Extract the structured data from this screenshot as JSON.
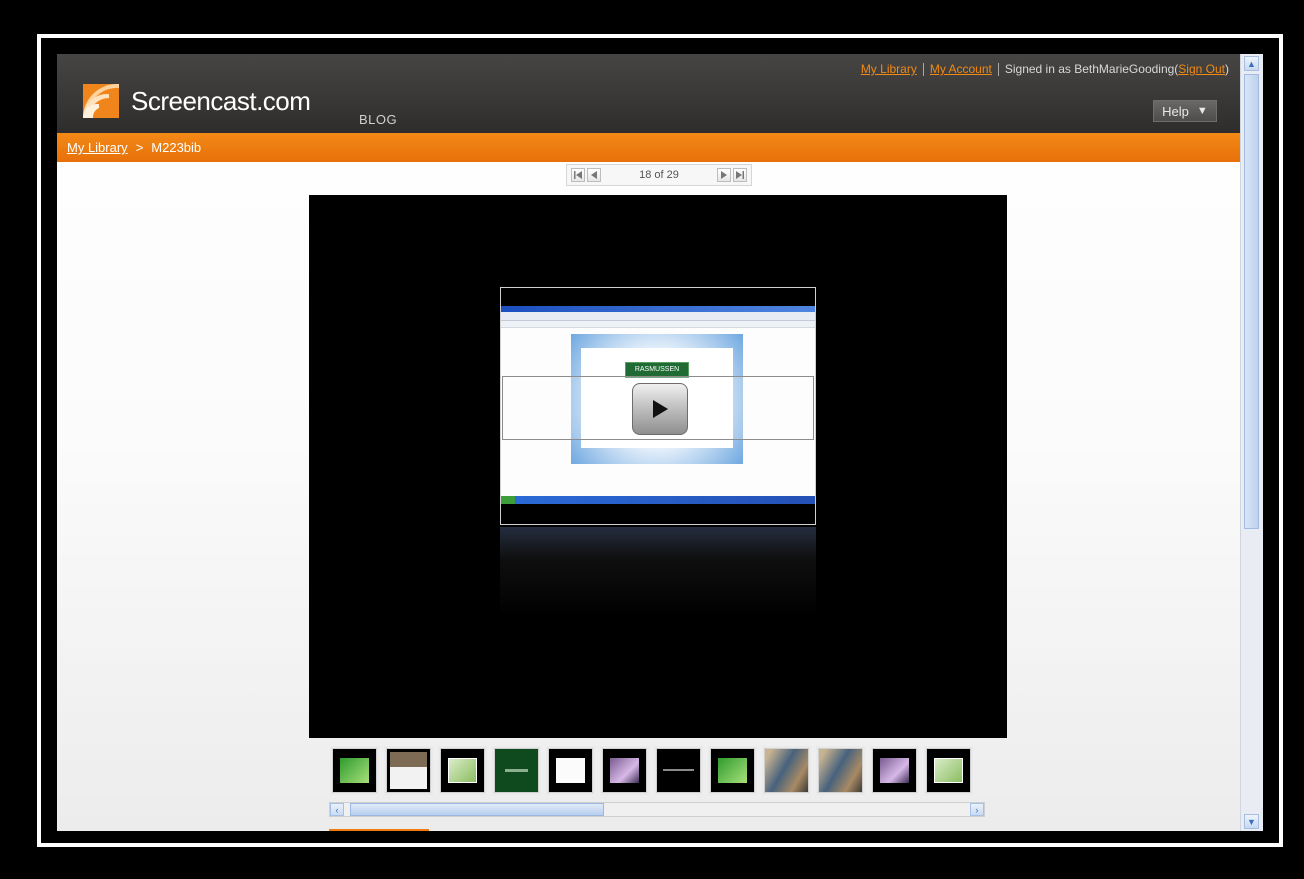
{
  "header": {
    "logo_text": "Screencast.com",
    "blog_label": "BLOG",
    "links": {
      "my_library": "My Library",
      "my_account": "My Account",
      "signed_in_prefix": "Signed in as BethMarieGooding(",
      "sign_out": "Sign Out",
      "signed_in_suffix": ")"
    },
    "help_label": "Help",
    "help_caret": "▼"
  },
  "breadcrumb": {
    "root": "My Library",
    "separator": ">",
    "current": "M223bib"
  },
  "pager": {
    "first_icon": "first-page-icon",
    "prev_icon": "previous-page-icon",
    "next_icon": "next-page-icon",
    "last_icon": "last-page-icon",
    "count_text": "18 of 29"
  },
  "player": {
    "play_icon": "play-icon",
    "preview_brand": "RASMUSSEN"
  },
  "filmstrip": {
    "thumbnails": [
      "green",
      "cover",
      "slide",
      "dkgreen",
      "white",
      "photo",
      "text",
      "green",
      "people",
      "people",
      "photo",
      "slide"
    ]
  },
  "scroll": {
    "left_arrow": "‹",
    "right_arrow": "›",
    "up_arrow": "▲",
    "down_arrow": "▼",
    "horizontal_position": 0.3
  },
  "colors": {
    "accent_orange": "#e7700a",
    "header_dark": "#3a3837",
    "link_orange": "#f08a12"
  }
}
